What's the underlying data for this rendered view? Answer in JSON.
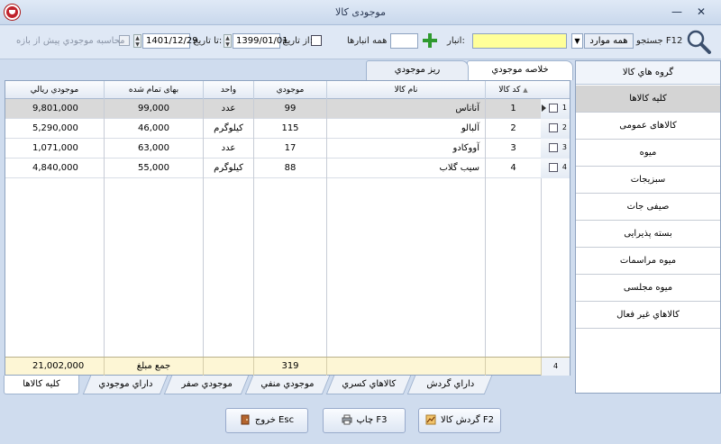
{
  "window": {
    "title": "موجودی کالا"
  },
  "toolbar": {
    "search_label": "جستجو F12",
    "filter_select": "همه موارد",
    "warehouse_label": "انبار:",
    "all_warehouses_label": "همه انبارها",
    "from_date_label": "از تاریخ:",
    "from_date": "1399/01/01",
    "to_date_label": "تا تاریخ:",
    "to_date": "1401/12/29",
    "calc_label": "محاسبه موجودي پيش از بازه"
  },
  "tabs_top": [
    "خلاصه موجودي",
    "ريز موجودي"
  ],
  "table": {
    "columns": [
      "كد كالا",
      "نام كالا",
      "موجودي",
      "واحد",
      "بهای تمام شده",
      "موجودي ريالي"
    ],
    "rows": [
      {
        "num": "1",
        "code": "1",
        "name": "آناناس",
        "qty": "99",
        "unit": "عدد",
        "cost": "99,000",
        "value": "9,801,000"
      },
      {
        "num": "2",
        "code": "2",
        "name": "آلبالو",
        "qty": "115",
        "unit": "کیلوگرم",
        "cost": "46,000",
        "value": "5,290,000"
      },
      {
        "num": "3",
        "code": "3",
        "name": "آووکادو",
        "qty": "17",
        "unit": "عدد",
        "cost": "63,000",
        "value": "1,071,000"
      },
      {
        "num": "4",
        "code": "4",
        "name": "سيب گلاب",
        "qty": "88",
        "unit": "کیلوگرم",
        "cost": "55,000",
        "value": "4,840,000"
      }
    ],
    "footer": {
      "count": "4",
      "qty_total": "319",
      "sum_label": "جمع مبلغ",
      "value_total": "21,002,000"
    }
  },
  "tabs_bottom": [
    "کلیه کالاها",
    "داراي موجودي",
    "موجودي صفر",
    "موجودي منفي",
    "كالاهاي كسري",
    "داراي گردش"
  ],
  "groups": {
    "title": "گروه هاي كالا",
    "items": [
      "کلیه کالاها",
      "کالاهای عمومی",
      "میوه",
      "سبزیجات",
      "صیفی جات",
      "بسته پذیرایی",
      "میوه مراسمات",
      "میوه مجلسی",
      "كالاهاي غير فعال"
    ]
  },
  "footer_buttons": {
    "circulation": "گردش کالا F2",
    "print": "چاپ F3",
    "exit": "خروج Esc"
  },
  "colors": {
    "accent": "#cfdcee",
    "search_field": "#ffff99",
    "selected_row": "#d9d9d9",
    "footer_row": "#fdf6d5"
  }
}
